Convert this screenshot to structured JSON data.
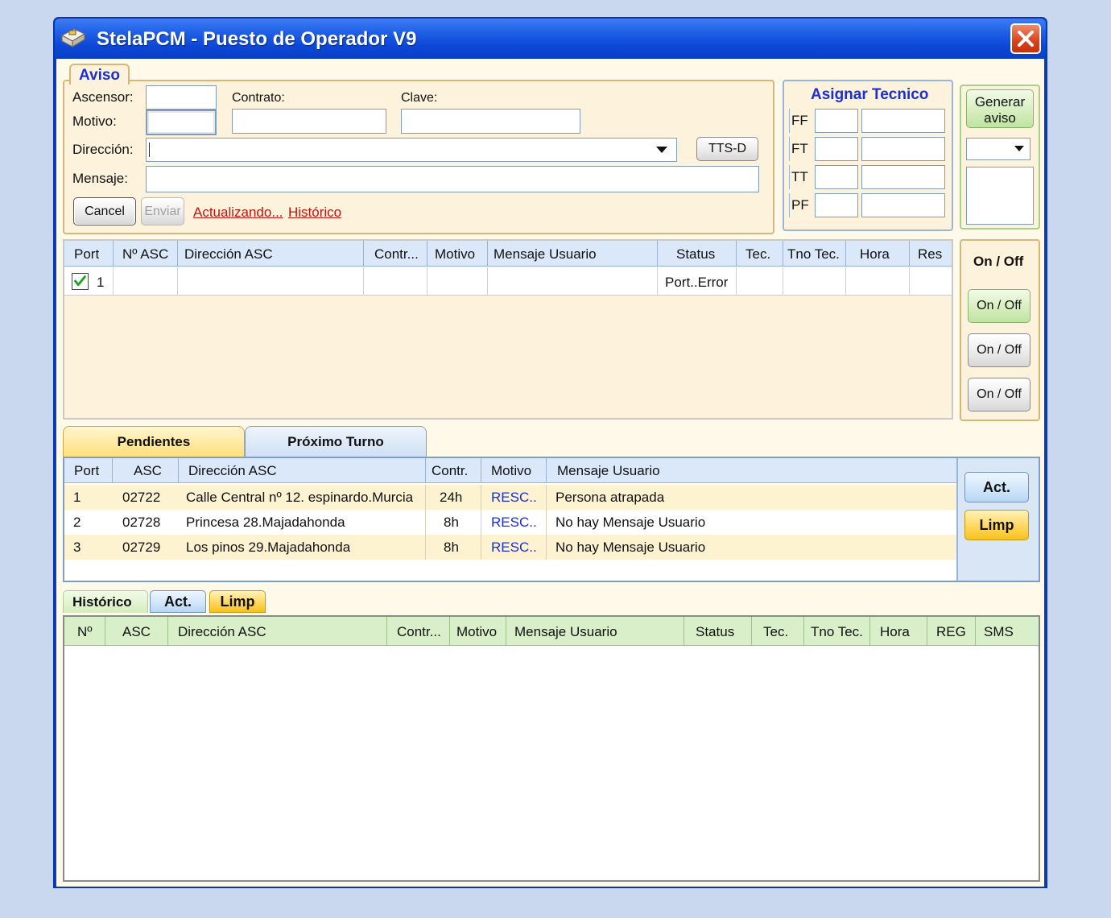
{
  "window": {
    "title": "StelaPCM - Puesto de Operador V9",
    "close_icon": "close-icon"
  },
  "aviso": {
    "legend": "Aviso",
    "ascensor_label": "Ascensor:",
    "motivo_label": "Motivo:",
    "contrato_label": "Contrato:",
    "clave_label": "Clave:",
    "direccion_label": "Dirección:",
    "mensaje_label": "Mensaje:",
    "tts_button": "TTS-D",
    "cancel_button": "Cancel",
    "enviar_button": "Enviar",
    "actualizando_link": "Actualizando...",
    "historico_link": "Histórico"
  },
  "asignar": {
    "title": "Asignar Tecnico",
    "rows": [
      "FF",
      "FT",
      "TT",
      "PF"
    ]
  },
  "generar": {
    "button": "Generar aviso"
  },
  "ports_grid": {
    "headers": [
      "Port",
      "Nº ASC",
      "Dirección ASC",
      "Contr...",
      "Motivo",
      "Mensaje Usuario",
      "Status",
      "Tec.",
      "Tno Tec.",
      "Hora",
      "Res"
    ],
    "rows": [
      {
        "port": "1",
        "checked": true,
        "asc": "",
        "direccion": "",
        "contr": "",
        "motivo": "",
        "mensaje": "",
        "status": "Port..Error",
        "tec": "",
        "tno": "",
        "hora": "",
        "res": ""
      }
    ]
  },
  "onoff": {
    "header": "On / Off",
    "buttons": [
      "On / Off",
      "On / Off",
      "On / Off"
    ]
  },
  "tabs": {
    "pendientes": "Pendientes",
    "proximo": "Próximo Turno"
  },
  "pend_grid": {
    "headers": [
      "Port",
      "ASC",
      "Dirección ASC",
      "Contr.",
      "Motivo",
      "Mensaje Usuario"
    ],
    "rows": [
      {
        "port": "1",
        "asc": "02722",
        "direccion": "Calle Central nº 12. espinardo.Murcia",
        "contr": "24h",
        "motivo": "RESC..",
        "mensaje": "Persona atrapada"
      },
      {
        "port": "2",
        "asc": "02728",
        "direccion": "Princesa 28.Majadahonda",
        "contr": "8h",
        "motivo": "RESC..",
        "mensaje": "No hay Mensaje Usuario"
      },
      {
        "port": "3",
        "asc": "02729",
        "direccion": "Los pinos 29.Majadahonda",
        "contr": "8h",
        "motivo": "RESC..",
        "mensaje": "No hay Mensaje Usuario"
      }
    ],
    "act_button": "Act.",
    "limp_button": "Limp"
  },
  "historico": {
    "label": "Histórico",
    "act_button": "Act.",
    "limp_button": "Limp",
    "headers": [
      "Nº",
      "ASC",
      "Dirección ASC",
      "Contr...",
      "Motivo",
      "Mensaje Usuario",
      "Status",
      "Tec.",
      "Tno Tec.",
      "Hora",
      "REG",
      "SMS"
    ]
  },
  "colors": {
    "titlebar": "#0b47d6",
    "accent_blue": "#1b2fd6",
    "link_red": "#c4120e",
    "row_alt": "#fdf3d0"
  }
}
